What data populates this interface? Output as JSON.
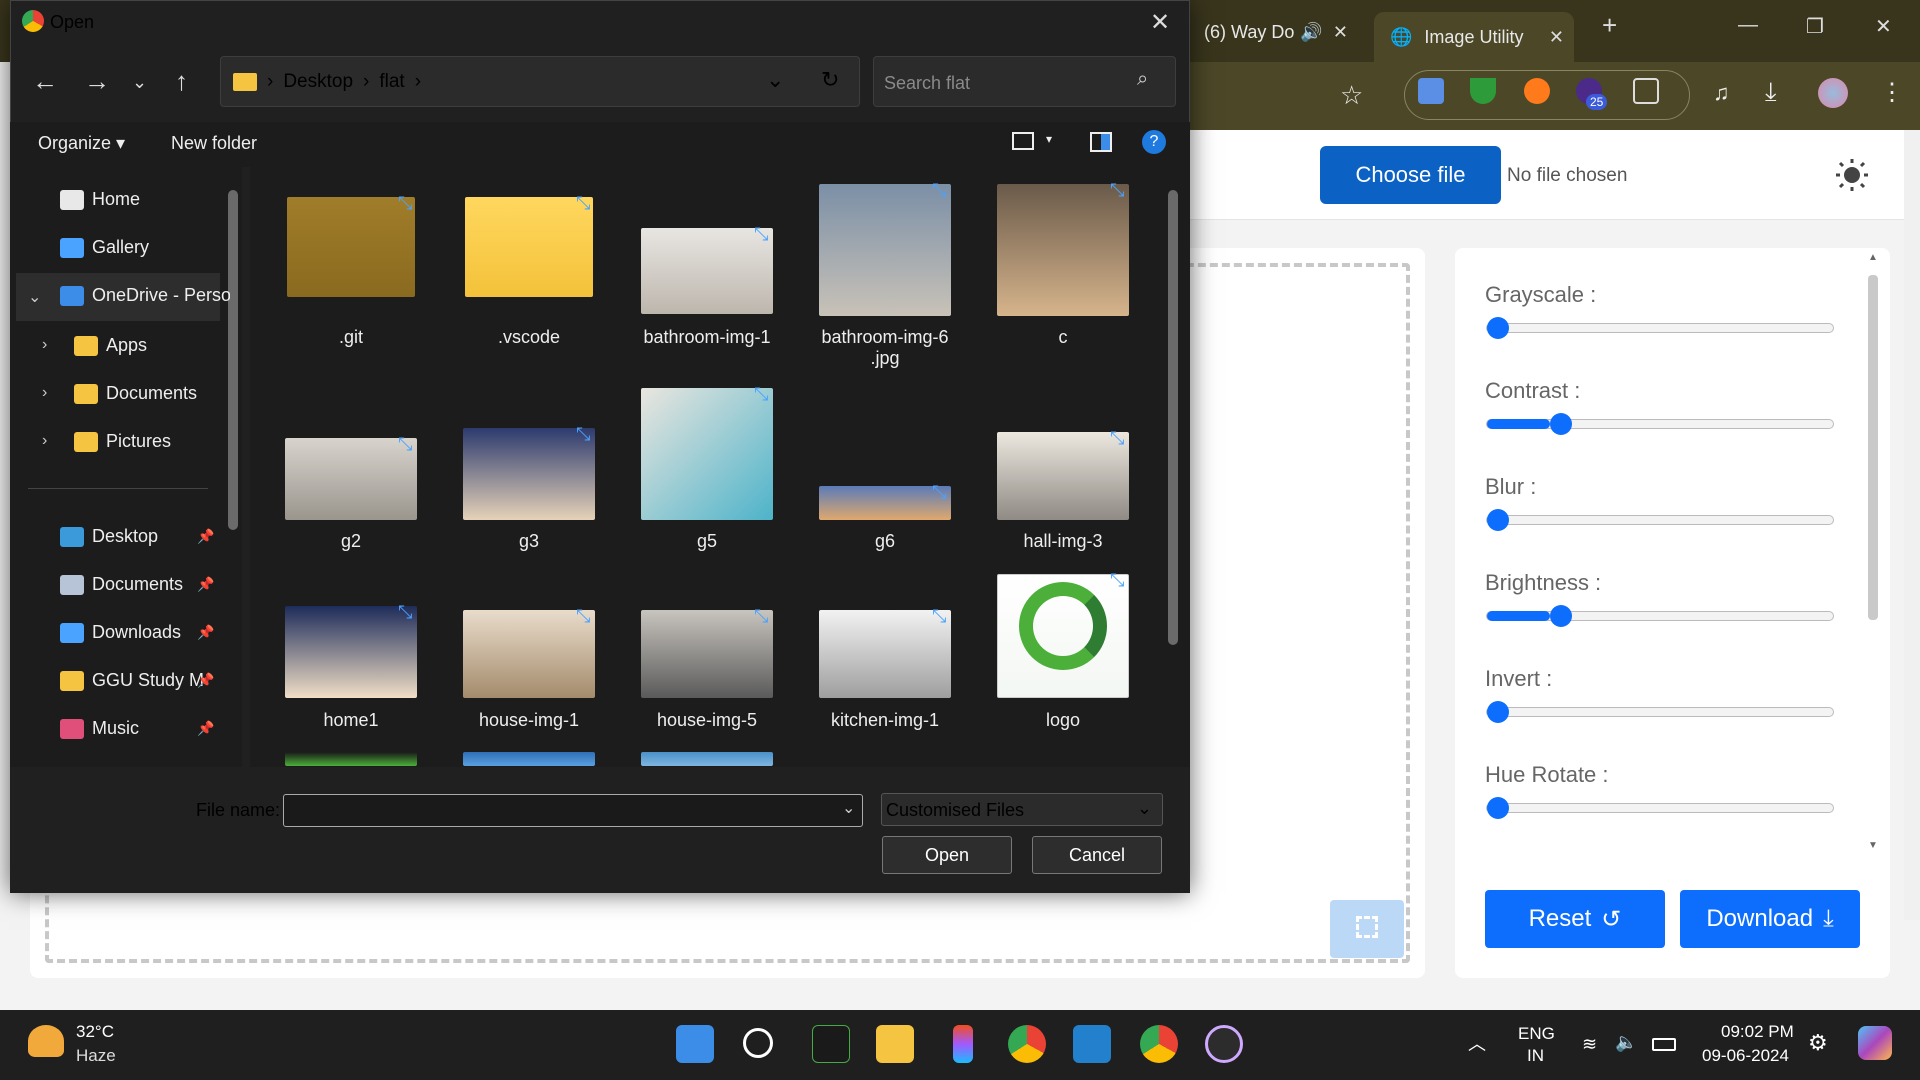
{
  "browser": {
    "tabs": [
      {
        "label": "(6) Way Do"
      },
      {
        "label": "Image Utility"
      }
    ],
    "new_tab": "+",
    "window": {
      "minimize": "—",
      "maximize": "❐",
      "close": "✕"
    },
    "ext_badge": "25"
  },
  "page": {
    "choose_file": "Choose file",
    "no_file": "No file chosen",
    "filters": [
      {
        "label": "Grayscale :",
        "value": 0
      },
      {
        "label": "Contrast :",
        "value": 18
      },
      {
        "label": "Blur :",
        "value": 0
      },
      {
        "label": "Brightness :",
        "value": 18
      },
      {
        "label": "Invert :",
        "value": 0
      },
      {
        "label": "Hue Rotate :",
        "value": 0
      }
    ],
    "reset": "Reset",
    "download": "Download",
    "accent": "#0d6efd"
  },
  "dialog": {
    "title": "Open",
    "path": [
      "Desktop",
      "flat"
    ],
    "search_placeholder": "Search flat",
    "organize": "Organize",
    "new_folder": "New folder",
    "nav": [
      {
        "label": "Home"
      },
      {
        "label": "Gallery"
      },
      {
        "label": "OneDrive - Perso"
      },
      {
        "label": "Apps"
      },
      {
        "label": "Documents"
      },
      {
        "label": "Pictures"
      },
      {
        "label": "Desktop"
      },
      {
        "label": "Documents"
      },
      {
        "label": "Downloads"
      },
      {
        "label": "GGU Study M"
      },
      {
        "label": "Music"
      }
    ],
    "files": [
      {
        "name": ".git"
      },
      {
        "name": ".vscode"
      },
      {
        "name": "bathroom-img-1"
      },
      {
        "name": "bathroom-img-6\n.jpg"
      },
      {
        "name": "c"
      },
      {
        "name": "g2"
      },
      {
        "name": "g3"
      },
      {
        "name": "g5"
      },
      {
        "name": "g6"
      },
      {
        "name": "hall-img-3"
      },
      {
        "name": "home1"
      },
      {
        "name": "house-img-1"
      },
      {
        "name": "house-img-5"
      },
      {
        "name": "kitchen-img-1"
      },
      {
        "name": "logo"
      }
    ],
    "file_name_label": "File name:",
    "file_name_value": "",
    "file_type": "Customised Files",
    "open": "Open",
    "cancel": "Cancel"
  },
  "taskbar": {
    "weather_temp": "32°C",
    "weather_desc": "Haze",
    "lang": "ENG",
    "region": "IN",
    "time": "09:02 PM",
    "date": "09-06-2024"
  }
}
